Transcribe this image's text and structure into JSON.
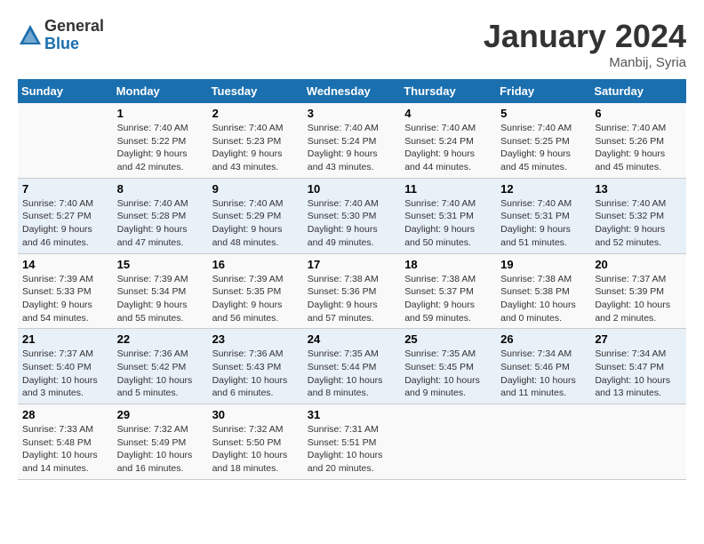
{
  "logo": {
    "general": "General",
    "blue": "Blue"
  },
  "title": "January 2024",
  "location": "Manbij, Syria",
  "days_header": [
    "Sunday",
    "Monday",
    "Tuesday",
    "Wednesday",
    "Thursday",
    "Friday",
    "Saturday"
  ],
  "weeks": [
    [
      {
        "day": "",
        "info": ""
      },
      {
        "day": "1",
        "info": "Sunrise: 7:40 AM\nSunset: 5:22 PM\nDaylight: 9 hours\nand 42 minutes."
      },
      {
        "day": "2",
        "info": "Sunrise: 7:40 AM\nSunset: 5:23 PM\nDaylight: 9 hours\nand 43 minutes."
      },
      {
        "day": "3",
        "info": "Sunrise: 7:40 AM\nSunset: 5:24 PM\nDaylight: 9 hours\nand 43 minutes."
      },
      {
        "day": "4",
        "info": "Sunrise: 7:40 AM\nSunset: 5:24 PM\nDaylight: 9 hours\nand 44 minutes."
      },
      {
        "day": "5",
        "info": "Sunrise: 7:40 AM\nSunset: 5:25 PM\nDaylight: 9 hours\nand 45 minutes."
      },
      {
        "day": "6",
        "info": "Sunrise: 7:40 AM\nSunset: 5:26 PM\nDaylight: 9 hours\nand 45 minutes."
      }
    ],
    [
      {
        "day": "7",
        "info": "Sunrise: 7:40 AM\nSunset: 5:27 PM\nDaylight: 9 hours\nand 46 minutes."
      },
      {
        "day": "8",
        "info": "Sunrise: 7:40 AM\nSunset: 5:28 PM\nDaylight: 9 hours\nand 47 minutes."
      },
      {
        "day": "9",
        "info": "Sunrise: 7:40 AM\nSunset: 5:29 PM\nDaylight: 9 hours\nand 48 minutes."
      },
      {
        "day": "10",
        "info": "Sunrise: 7:40 AM\nSunset: 5:30 PM\nDaylight: 9 hours\nand 49 minutes."
      },
      {
        "day": "11",
        "info": "Sunrise: 7:40 AM\nSunset: 5:31 PM\nDaylight: 9 hours\nand 50 minutes."
      },
      {
        "day": "12",
        "info": "Sunrise: 7:40 AM\nSunset: 5:31 PM\nDaylight: 9 hours\nand 51 minutes."
      },
      {
        "day": "13",
        "info": "Sunrise: 7:40 AM\nSunset: 5:32 PM\nDaylight: 9 hours\nand 52 minutes."
      }
    ],
    [
      {
        "day": "14",
        "info": "Sunrise: 7:39 AM\nSunset: 5:33 PM\nDaylight: 9 hours\nand 54 minutes."
      },
      {
        "day": "15",
        "info": "Sunrise: 7:39 AM\nSunset: 5:34 PM\nDaylight: 9 hours\nand 55 minutes."
      },
      {
        "day": "16",
        "info": "Sunrise: 7:39 AM\nSunset: 5:35 PM\nDaylight: 9 hours\nand 56 minutes."
      },
      {
        "day": "17",
        "info": "Sunrise: 7:38 AM\nSunset: 5:36 PM\nDaylight: 9 hours\nand 57 minutes."
      },
      {
        "day": "18",
        "info": "Sunrise: 7:38 AM\nSunset: 5:37 PM\nDaylight: 9 hours\nand 59 minutes."
      },
      {
        "day": "19",
        "info": "Sunrise: 7:38 AM\nSunset: 5:38 PM\nDaylight: 10 hours\nand 0 minutes."
      },
      {
        "day": "20",
        "info": "Sunrise: 7:37 AM\nSunset: 5:39 PM\nDaylight: 10 hours\nand 2 minutes."
      }
    ],
    [
      {
        "day": "21",
        "info": "Sunrise: 7:37 AM\nSunset: 5:40 PM\nDaylight: 10 hours\nand 3 minutes."
      },
      {
        "day": "22",
        "info": "Sunrise: 7:36 AM\nSunset: 5:42 PM\nDaylight: 10 hours\nand 5 minutes."
      },
      {
        "day": "23",
        "info": "Sunrise: 7:36 AM\nSunset: 5:43 PM\nDaylight: 10 hours\nand 6 minutes."
      },
      {
        "day": "24",
        "info": "Sunrise: 7:35 AM\nSunset: 5:44 PM\nDaylight: 10 hours\nand 8 minutes."
      },
      {
        "day": "25",
        "info": "Sunrise: 7:35 AM\nSunset: 5:45 PM\nDaylight: 10 hours\nand 9 minutes."
      },
      {
        "day": "26",
        "info": "Sunrise: 7:34 AM\nSunset: 5:46 PM\nDaylight: 10 hours\nand 11 minutes."
      },
      {
        "day": "27",
        "info": "Sunrise: 7:34 AM\nSunset: 5:47 PM\nDaylight: 10 hours\nand 13 minutes."
      }
    ],
    [
      {
        "day": "28",
        "info": "Sunrise: 7:33 AM\nSunset: 5:48 PM\nDaylight: 10 hours\nand 14 minutes."
      },
      {
        "day": "29",
        "info": "Sunrise: 7:32 AM\nSunset: 5:49 PM\nDaylight: 10 hours\nand 16 minutes."
      },
      {
        "day": "30",
        "info": "Sunrise: 7:32 AM\nSunset: 5:50 PM\nDaylight: 10 hours\nand 18 minutes."
      },
      {
        "day": "31",
        "info": "Sunrise: 7:31 AM\nSunset: 5:51 PM\nDaylight: 10 hours\nand 20 minutes."
      },
      {
        "day": "",
        "info": ""
      },
      {
        "day": "",
        "info": ""
      },
      {
        "day": "",
        "info": ""
      }
    ]
  ]
}
